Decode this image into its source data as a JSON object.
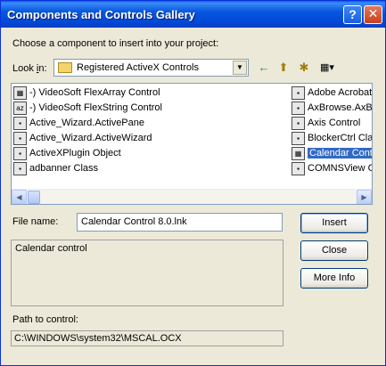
{
  "window": {
    "title": "Components and Controls Gallery",
    "help_button": "?",
    "close_button": "✕"
  },
  "prompt": "Choose a component to insert into your project:",
  "look_in": {
    "label_pre": "Look ",
    "label_u": "i",
    "label_post": "n:",
    "value": "Registered ActiveX Controls"
  },
  "toolbar": {
    "back_icon": "←",
    "up_icon": "⬆",
    "new_folder_icon": "✱",
    "view_menu_icon": "▦▾"
  },
  "list": {
    "column1": [
      {
        "label": "-) VideoSoft FlexArray Control",
        "icon": "grid-icon"
      },
      {
        "label": "-) VideoSoft FlexString Control",
        "icon": "az-icon"
      },
      {
        "label": "Active_Wizard.ActivePane",
        "icon": "control-icon"
      },
      {
        "label": "Active_Wizard.ActiveWizard",
        "icon": "control-icon"
      },
      {
        "label": "ActiveXPlugin Object",
        "icon": "control-icon"
      },
      {
        "label": "adbanner Class",
        "icon": "control-icon"
      }
    ],
    "column2": [
      {
        "label": "Adobe Acrobat",
        "icon": "control-icon"
      },
      {
        "label": "AxBrowse.AxBr",
        "icon": "control-icon"
      },
      {
        "label": "Axis Control",
        "icon": "control-icon"
      },
      {
        "label": "BlockerCtrl Cla",
        "icon": "control-icon"
      },
      {
        "label": "Calendar Contr",
        "icon": "calendar-icon",
        "selected": true
      },
      {
        "label": "COMNSView Cl",
        "icon": "control-icon"
      }
    ]
  },
  "file_name": {
    "label": "File name:",
    "value": "Calendar Control 8.0.lnk"
  },
  "buttons": {
    "insert": "Insert",
    "close": "Close",
    "more_info": "More Info"
  },
  "description": "Calendar control",
  "path": {
    "label": "Path to control:",
    "value": "C:\\WINDOWS\\system32\\MSCAL.OCX"
  },
  "colors": {
    "titlebar": "#0a5fe8",
    "dialog_bg": "#ece9d8",
    "selection": "#316ac5"
  }
}
